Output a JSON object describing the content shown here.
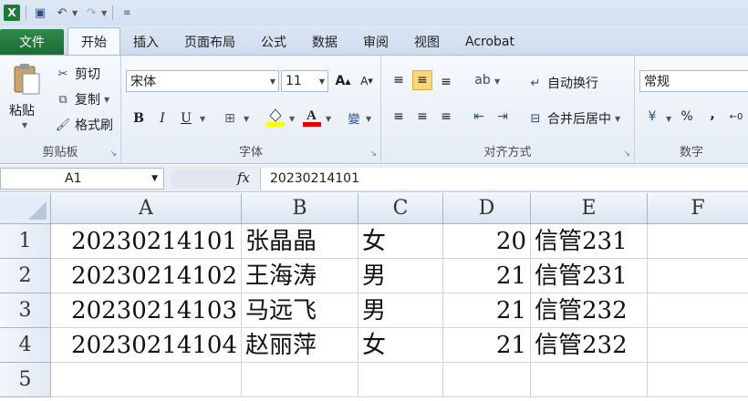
{
  "qat": {
    "logo": "X"
  },
  "tabs": [
    "文件",
    "开始",
    "插入",
    "页面布局",
    "公式",
    "数据",
    "审阅",
    "视图",
    "Acrobat"
  ],
  "clipboard": {
    "paste": "粘贴",
    "cut": "剪切",
    "copy": "复制",
    "format_painter": "格式刷",
    "label": "剪贴板"
  },
  "font": {
    "name": "宋体",
    "size": "11",
    "bold": "B",
    "italic": "I",
    "underline": "U",
    "label": "字体"
  },
  "alignment": {
    "wrap": "自动换行",
    "merge": "合并后居中",
    "label": "对齐方式"
  },
  "number": {
    "format": "常规",
    "percent": "%",
    "comma": ",",
    "label": "数字"
  },
  "formula_bar": {
    "name_box": "A1",
    "fx": "fx",
    "value": "20230214101"
  },
  "columns": [
    "A",
    "B",
    "C",
    "D",
    "E",
    "F"
  ],
  "rows": [
    {
      "num": "1",
      "cells": [
        "20230214101",
        "张晶晶",
        "女",
        "20",
        "信管231",
        ""
      ]
    },
    {
      "num": "2",
      "cells": [
        "20230214102",
        "王海涛",
        "男",
        "21",
        "信管231",
        ""
      ]
    },
    {
      "num": "3",
      "cells": [
        "20230214103",
        "马远飞",
        "男",
        "21",
        "信管232",
        ""
      ]
    },
    {
      "num": "4",
      "cells": [
        "20230214104",
        "赵丽萍",
        "女",
        "21",
        "信管232",
        ""
      ]
    },
    {
      "num": "5",
      "cells": [
        "",
        "",
        "",
        "",
        "",
        ""
      ]
    }
  ]
}
